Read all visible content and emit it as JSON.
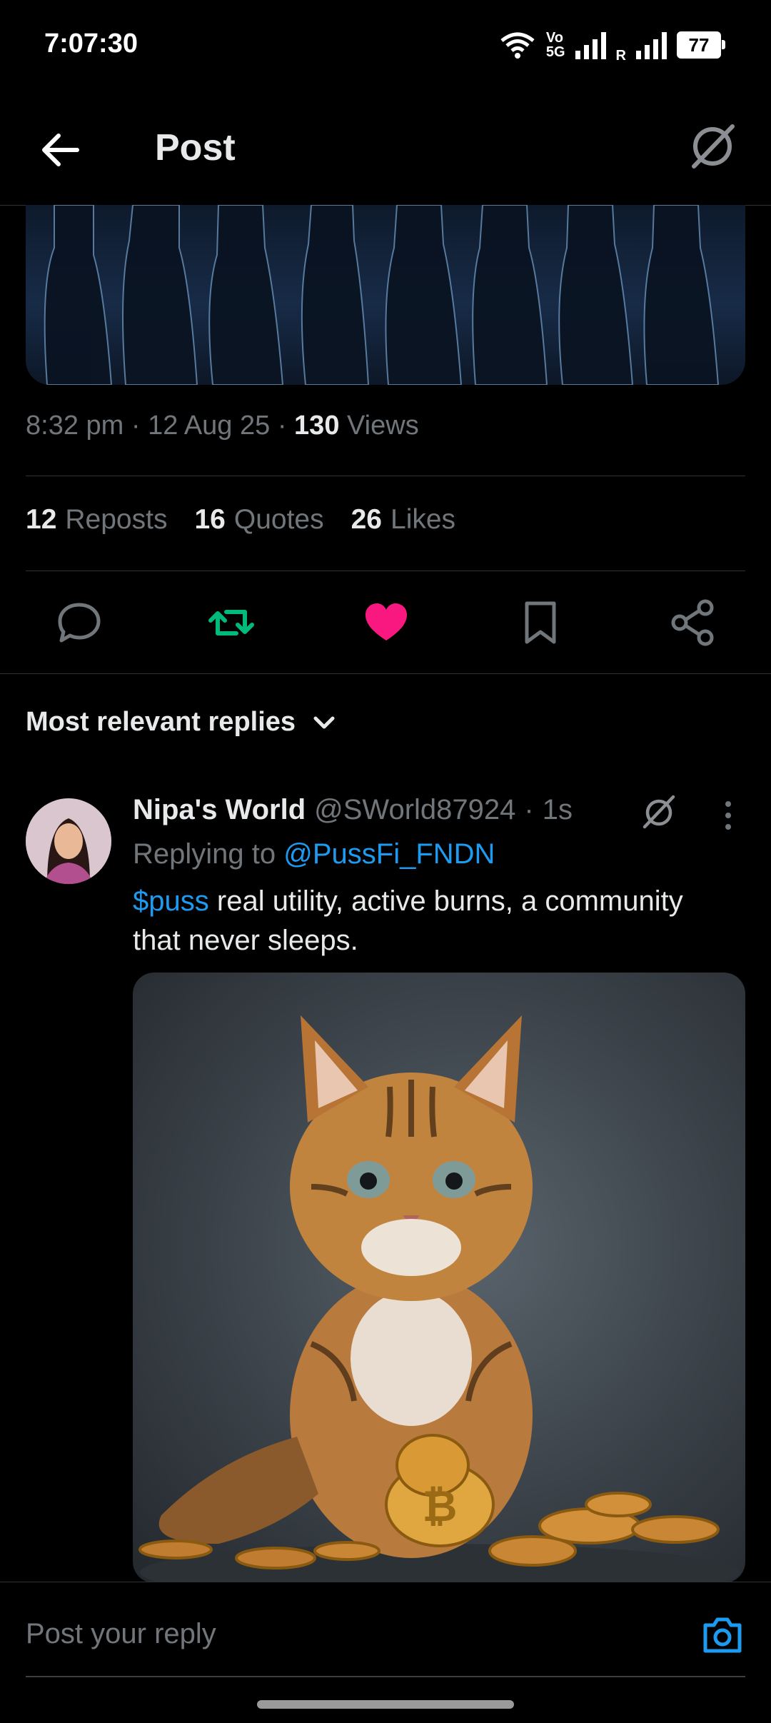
{
  "status_bar": {
    "time": "7:07:30",
    "net1": "Vo",
    "net2": "5G",
    "roaming": "R",
    "battery": "77"
  },
  "header": {
    "title": "Post"
  },
  "post": {
    "time": "8:32 pm",
    "date": "12 Aug 25",
    "views_count": "130",
    "views_label": "Views",
    "reposts_count": "12",
    "reposts_label": "Reposts",
    "quotes_count": "16",
    "quotes_label": "Quotes",
    "likes_count": "26",
    "likes_label": "Likes",
    "liked": true,
    "reposted": true
  },
  "replies": {
    "sort_label": "Most relevant replies",
    "items": [
      {
        "name": "Nipa's World",
        "handle": "@SWorld87924",
        "time": "1s",
        "replying_prefix": "Replying to",
        "replying_to": "@PussFi_FNDN",
        "cashtag": "$puss",
        "text": "real utility, active burns, a community that never sleeps."
      }
    ]
  },
  "compose": {
    "placeholder": "Post your reply"
  },
  "colors": {
    "accent": "#1d9bf0",
    "like": "#f91880",
    "repost": "#00ba7c",
    "muted": "#71767b"
  },
  "icons": [
    "back-arrow-icon",
    "grok-icon",
    "reply-icon",
    "repost-icon",
    "heart-icon",
    "bookmark-icon",
    "share-icon",
    "chevron-down-icon",
    "more-icon",
    "camera-icon",
    "wifi-icon",
    "signal-icon",
    "battery-icon"
  ]
}
